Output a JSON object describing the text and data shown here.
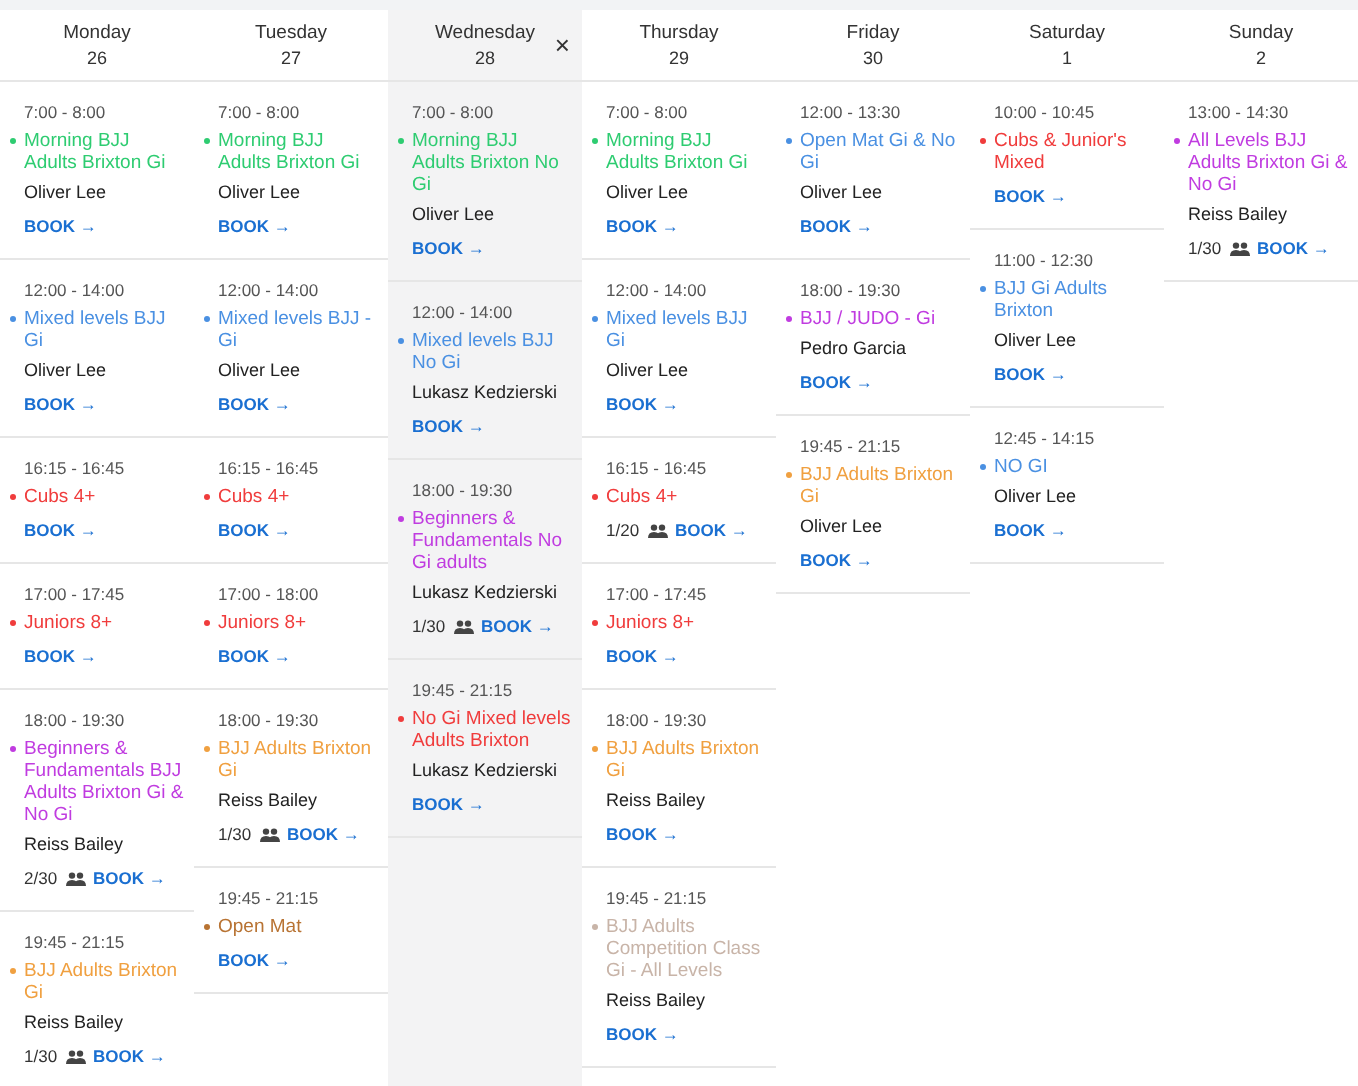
{
  "days": [
    {
      "name": "Monday",
      "date": "26",
      "selected": false,
      "events": [
        {
          "time": "7:00 - 8:00",
          "title": "Morning BJJ Adults Brixton Gi",
          "color": "#2ecc71",
          "instructor": "Oliver Lee",
          "book": "BOOK →"
        },
        {
          "time": "12:00 - 14:00",
          "title": "Mixed levels BJJ Gi",
          "color": "#4a90e2",
          "instructor": "Oliver Lee",
          "book": "BOOK →"
        },
        {
          "time": "16:15 - 16:45",
          "title": "Cubs 4+",
          "color": "#f03c3c",
          "book": "BOOK →"
        },
        {
          "time": "17:00 - 17:45",
          "title": "Juniors 8+",
          "color": "#f03c3c",
          "book": "BOOK →"
        },
        {
          "time": "18:00 - 19:30",
          "title": "Beginners & Fundamentals BJJ Adults Brixton Gi & No Gi",
          "color": "#c03ce0",
          "instructor": "Reiss Bailey",
          "capacity": "2/30",
          "book": "BOOK →"
        },
        {
          "time": "19:45 - 21:15",
          "title": "BJJ Adults Brixton Gi",
          "color": "#f0a040",
          "instructor": "Reiss Bailey",
          "capacity": "1/30",
          "book": "BOOK →"
        }
      ]
    },
    {
      "name": "Tuesday",
      "date": "27",
      "selected": false,
      "events": [
        {
          "time": "7:00 - 8:00",
          "title": "Morning BJJ Adults Brixton Gi",
          "color": "#2ecc71",
          "instructor": "Oliver Lee",
          "book": "BOOK →"
        },
        {
          "time": "12:00 - 14:00",
          "title": "Mixed levels BJJ - Gi",
          "color": "#4a90e2",
          "instructor": "Oliver Lee",
          "book": "BOOK →"
        },
        {
          "time": "16:15 - 16:45",
          "title": "Cubs 4+",
          "color": "#f03c3c",
          "book": "BOOK →"
        },
        {
          "time": "17:00 - 18:00",
          "title": "Juniors 8+",
          "color": "#f03c3c",
          "book": "BOOK →"
        },
        {
          "time": "18:00 - 19:30",
          "title": "BJJ Adults Brixton Gi",
          "color": "#f0a040",
          "instructor": "Reiss Bailey",
          "capacity": "1/30",
          "book": "BOOK →"
        },
        {
          "time": "19:45 - 21:15",
          "title": "Open Mat",
          "color": "#b87333",
          "book": "BOOK →"
        }
      ]
    },
    {
      "name": "Wednesday",
      "date": "28",
      "selected": true,
      "close": "×",
      "events": [
        {
          "time": "7:00 - 8:00",
          "title": "Morning BJJ Adults Brixton No Gi",
          "color": "#2ecc71",
          "instructor": "Oliver Lee",
          "book": "BOOK →"
        },
        {
          "time": "12:00 - 14:00",
          "title": "Mixed levels BJJ No Gi",
          "color": "#4a90e2",
          "instructor": "Lukasz Kedzierski",
          "book": "BOOK →"
        },
        {
          "time": "18:00 - 19:30",
          "title": "Beginners & Fundamentals No Gi adults",
          "color": "#c03ce0",
          "instructor": "Lukasz Kedzierski",
          "capacity": "1/30",
          "book": "BOOK →"
        },
        {
          "time": "19:45 - 21:15",
          "title": "No Gi Mixed levels Adults Brixton",
          "color": "#f03c3c",
          "instructor": "Lukasz Kedzierski",
          "book": "BOOK →"
        }
      ]
    },
    {
      "name": "Thursday",
      "date": "29",
      "selected": false,
      "events": [
        {
          "time": "7:00 - 8:00",
          "title": "Morning BJJ Adults Brixton Gi",
          "color": "#2ecc71",
          "instructor": "Oliver Lee",
          "book": "BOOK →"
        },
        {
          "time": "12:00 - 14:00",
          "title": "Mixed levels BJJ Gi",
          "color": "#4a90e2",
          "instructor": "Oliver Lee",
          "book": "BOOK →"
        },
        {
          "time": "16:15 - 16:45",
          "title": "Cubs 4+",
          "color": "#f03c3c",
          "capacity": "1/20",
          "book": "BOOK →"
        },
        {
          "time": "17:00 - 17:45",
          "title": "Juniors 8+",
          "color": "#f03c3c",
          "book": "BOOK →"
        },
        {
          "time": "18:00 - 19:30",
          "title": "BJJ Adults Brixton Gi",
          "color": "#f0a040",
          "instructor": "Reiss Bailey",
          "book": "BOOK →"
        },
        {
          "time": "19:45 - 21:15",
          "title": "BJJ Adults Competition Class Gi - All Levels",
          "color": "#c8b4a8",
          "instructor": "Reiss Bailey",
          "book": "BOOK →"
        }
      ]
    },
    {
      "name": "Friday",
      "date": "30",
      "selected": false,
      "events": [
        {
          "time": "12:00 - 13:30",
          "title": "Open Mat Gi & No Gi",
          "color": "#4a90e2",
          "instructor": "Oliver Lee",
          "book": "BOOK →"
        },
        {
          "time": "18:00 - 19:30",
          "title": "BJJ / JUDO - Gi",
          "color": "#c03ce0",
          "instructor": "Pedro Garcia",
          "book": "BOOK →"
        },
        {
          "time": "19:45 - 21:15",
          "title": "BJJ Adults Brixton Gi",
          "color": "#f0a040",
          "instructor": "Oliver Lee",
          "book": "BOOK →"
        }
      ]
    },
    {
      "name": "Saturday",
      "date": "1",
      "selected": false,
      "events": [
        {
          "time": "10:00 - 10:45",
          "title": "Cubs & Junior's Mixed",
          "color": "#f03c3c",
          "book": "BOOK →"
        },
        {
          "time": "11:00 - 12:30",
          "title": "BJJ Gi Adults Brixton",
          "color": "#4a90e2",
          "instructor": "Oliver Lee",
          "book": "BOOK →"
        },
        {
          "time": "12:45 - 14:15",
          "title": "NO GI",
          "color": "#4a90e2",
          "instructor": "Oliver Lee",
          "book": "BOOK →"
        }
      ]
    },
    {
      "name": "Sunday",
      "date": "2",
      "selected": false,
      "events": [
        {
          "time": "13:00 - 14:30",
          "title": "All Levels BJJ Adults Brixton Gi & No Gi",
          "color": "#c03ce0",
          "instructor": "Reiss Bailey",
          "capacity": "1/30",
          "book": "BOOK →"
        }
      ]
    }
  ]
}
